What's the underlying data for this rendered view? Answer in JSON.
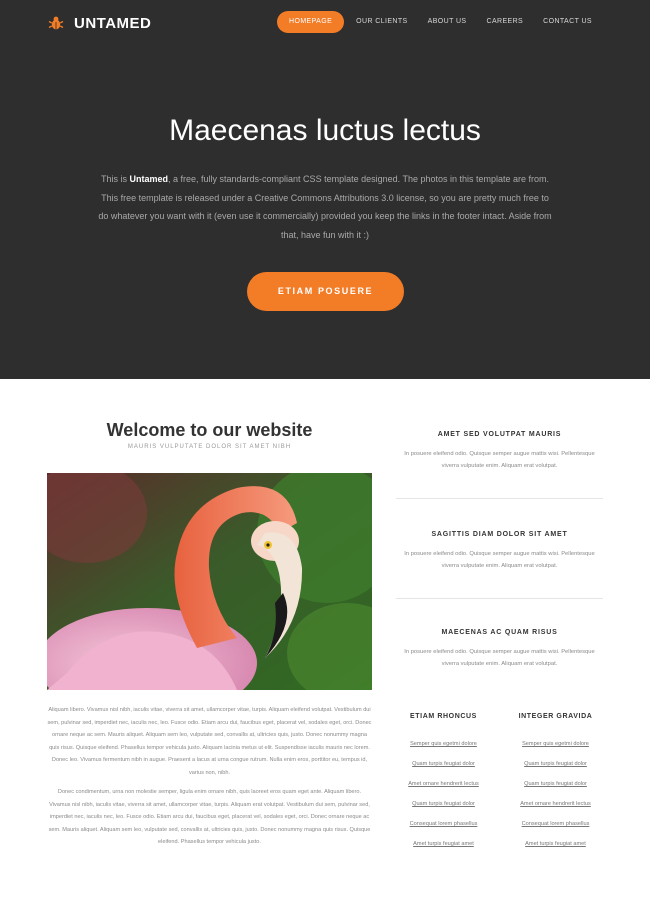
{
  "brand": {
    "name": "UNTAMED",
    "icon": "bug-icon",
    "accent": "#f37c27"
  },
  "nav": {
    "items": [
      "HOMEPAGE",
      "OUR CLIENTS",
      "ABOUT US",
      "CAREERS",
      "CONTACT US"
    ],
    "active": "HOMEPAGE"
  },
  "hero": {
    "title": "Maecenas luctus lectus",
    "text_before": "This is ",
    "text_brand": "Untamed",
    "text_after": ", a free, fully standards-compliant CSS template designed. The photos in this template are from. This free template is released under a Creative Commons Attributions 3.0 license, so you are pretty much free to do whatever you want with it (even use it commercially) provided you keep the links in the footer intact. Aside from that, have fun with it :)",
    "button": "ETIAM POSUERE"
  },
  "welcome": {
    "title": "Welcome to our website",
    "subtitle": "MAURIS VULPUTATE DOLOR SIT AMET NIBH",
    "paragraph1": "Aliquam libero. Vivamus nisl nibh, iaculis vitae, viverra sit amet, ullamcorper vitae, turpis. Aliquam eleifend volutpat. Vestibulum dui sem, pulvinar sed, imperdiet nec, iaculis nec, leo. Fusce odio. Etiam arcu dui, faucibus eget, placerat vel, sodales eget, orci. Donec ornare neque ac sem. Mauris aliquet. Aliquam sem leo, vulputate sed, convallis at, ultricies quis, justo. Donec nonummy magna quis risus. Quisque eleifend. Phasellus tempor vehicula justo. Aliquam lacinia metus ut elit. Suspendisse iaculis mauris nec lorem. Donec leo. Vivamus fermentum nibh in augue. Praesent a lacus at urna congue rutrum. Nulla enim eros, porttitor eu, tempus id, varius non, nibh.",
    "paragraph2": "Donec condimentum, urna non molestie semper, ligula enim ornare nibh, quis laoreet eros quam eget ante. Aliquam libero. Vivamus nisl nibh, iaculis vitae, viverra sit amet, ullamcorper vitae, turpis. Aliquam erat volutpat. Vestibulum dui sem, pulvinar sed, imperdiet nec, iaculis nec, leo. Fusce odio. Etiam arcu dui, faucibus eget, placerat vel, sodales eget, orci. Donec ornare neque ac sem. Mauris aliquet. Aliquam sem leo, vulputate sed, convallis at, ultricies quis, justo. Donec nonummy magna quis risus. Quisque eleifend. Phasellus tempor vehicula justo."
  },
  "sidebar": {
    "blocks": [
      {
        "title": "AMET SED VOLUTPAT MAURIS",
        "text": "In posuere eleifend odio. Quisque semper augue mattis wisi. Pellentesque viverra vulputate enim. Aliquam erat volutpat."
      },
      {
        "title": "SAGITTIS DIAM DOLOR SIT AMET",
        "text": "In posuere eleifend odio. Quisque semper augue mattis wisi. Pellentesque viverra vulputate enim. Aliquam erat volutpat."
      },
      {
        "title": "MAECENAS AC QUAM RISUS",
        "text": "In posuere eleifend odio. Quisque semper augue mattis wisi. Pellentesque viverra vulputate enim. Aliquam erat volutpat."
      }
    ],
    "link_columns": [
      {
        "title": "ETIAM RHONCUS",
        "links": [
          "Semper quis egetmi dolore",
          "Quam turpis feugiat dolor",
          "Amet ornare hendrerit lectus",
          "Quam turpis feugiat dolor",
          "Consequat lorem phasellus",
          "Amet turpis feugiat amet"
        ]
      },
      {
        "title": "INTEGER GRAVIDA",
        "links": [
          "Semper quis egetmi dolore",
          "Quam turpis feugiat dolor",
          "Quam turpis feugiat dolor",
          "Amet ornare hendrerit lectus",
          "Consequat lorem phasellus",
          "Amet turpis feugiat amet"
        ]
      }
    ]
  }
}
